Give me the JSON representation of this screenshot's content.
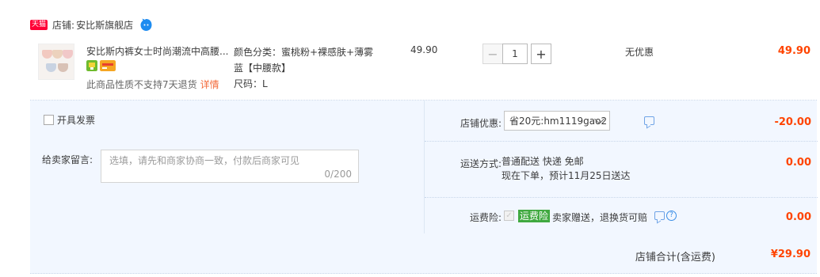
{
  "shop": {
    "badge": "天猫",
    "label": "店铺:",
    "name": "安比斯旗舰店",
    "chat_icon": "wangwang-chat-icon"
  },
  "item": {
    "title": "安比斯内裤女士时尚潮流中高腰...",
    "promo_icons": [
      "promo-badge-green-icon",
      "card-payment-icon"
    ],
    "notice": "此商品性质不支持7天退货",
    "notice_link": "详情",
    "sku_line1": "颜色分类：蜜桃粉+裸感肤+薄雾",
    "sku_line2": "蓝【中腰款】",
    "sku_line3": "尺码：L",
    "unit_price": "49.90",
    "qty_minus": "−",
    "qty_value": "1",
    "qty_plus": "+",
    "discount_text": "无优惠",
    "line_total": "49.90"
  },
  "order": {
    "invoice_label": "开具发票",
    "message_label": "给卖家留言:",
    "message_placeholder": "选填，请先和商家协商一致，付款后商家可见",
    "message_count": "0/200",
    "coupon_label": "店铺优惠:",
    "coupon_value": "省20元:hm1119gao2",
    "coupon_amount": "-20.00",
    "shipping_label": "运送方式:",
    "shipping_line1": "普通配送 快递 免邮",
    "shipping_line2": "现在下单，预计11月25日送达",
    "shipping_amount": "0.00",
    "insurance_label": "运费险:",
    "insurance_badge": "运费险",
    "insurance_text": "卖家赠送，退换货可赔",
    "insurance_amount": "0.00",
    "total_label": "店铺合计(含运费)",
    "total_value": "¥29.90"
  },
  "colors": {
    "price": "#ff4400",
    "panel_bg": "#f2f7ff",
    "tmall_red": "#ff0036",
    "insurance_green": "#40a940"
  }
}
